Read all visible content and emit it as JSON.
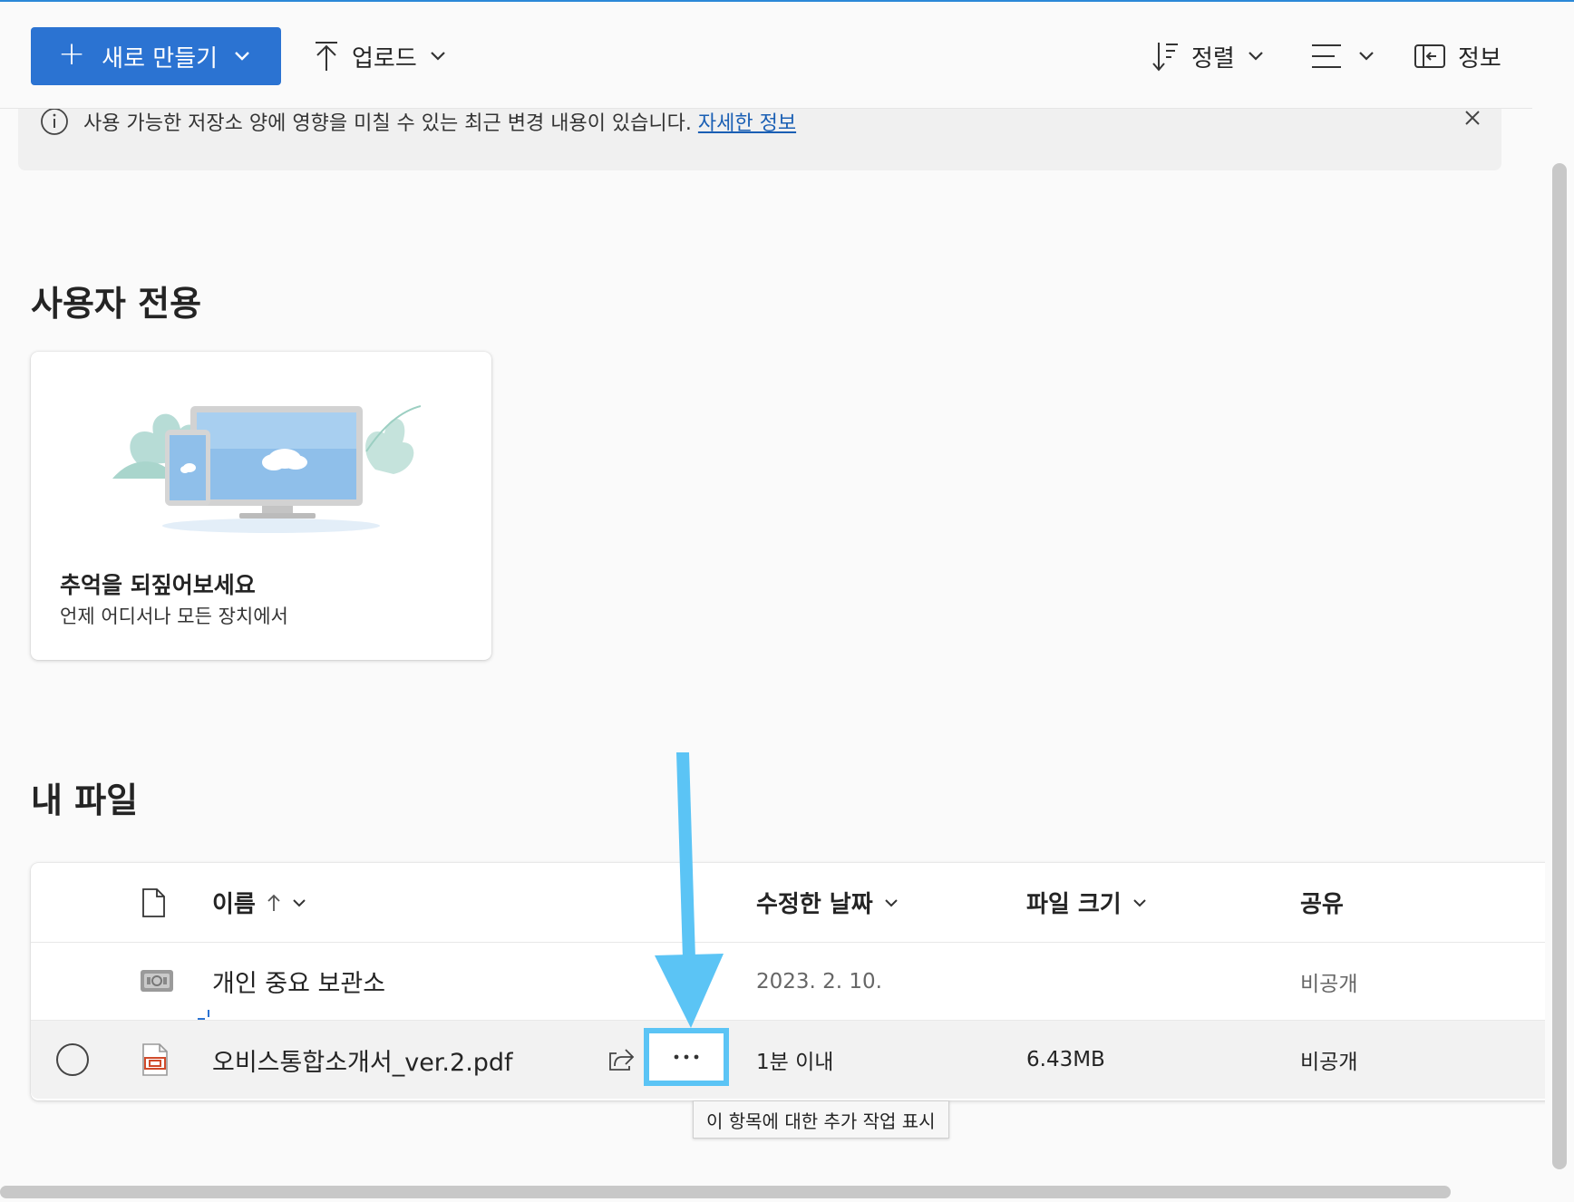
{
  "toolbar": {
    "new_label": "새로 만들기",
    "upload_label": "업로드",
    "sort_label": "정렬",
    "info_label": "정보"
  },
  "banner": {
    "message": "사용 가능한 저장소 양에 영향을 미칠 수 있는 최근 변경 내용이 있습니다.",
    "link": "자세한 정보"
  },
  "for_you": {
    "heading": "사용자 전용",
    "card_title": "추억을 되짚어보세요",
    "card_subtitle": "언제 어디서나 모든 장치에서"
  },
  "my_files": {
    "heading": "내 파일",
    "columns": {
      "name": "이름",
      "modified": "수정한 날짜",
      "size": "파일 크기",
      "sharing": "공유"
    },
    "rows": [
      {
        "icon": "vault-icon",
        "name": "개인 중요 보관소",
        "modified": "2023. 2. 10.",
        "size": "",
        "sharing": "비공개"
      },
      {
        "icon": "pdf-file-icon",
        "name": "오비스통합소개서_ver.2.pdf",
        "modified": "1분 이내",
        "size": "6.43MB",
        "sharing": "비공개"
      }
    ]
  },
  "tooltip": "이 항목에 대한 추가 작업 표시",
  "colors": {
    "accent": "#2b73d2",
    "annotation": "#5bc4f5"
  }
}
